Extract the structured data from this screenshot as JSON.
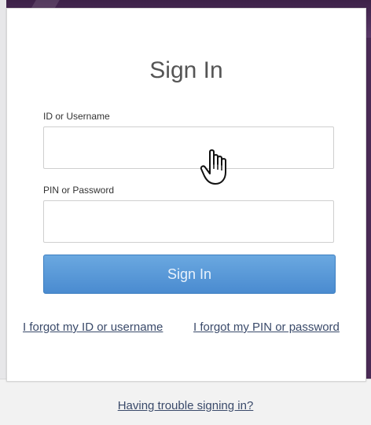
{
  "form": {
    "title": "Sign In",
    "username_label": "ID or Username",
    "username_value": "",
    "password_label": "PIN or Password",
    "password_value": "",
    "submit_label": "Sign In"
  },
  "links": {
    "forgot_id": "I forgot my ID or username",
    "forgot_pin": "I forgot my PIN or password",
    "trouble": "Having trouble signing in?"
  },
  "icons": {
    "cursor": "hand-pointer-icon"
  },
  "colors": {
    "frame": "#4a2a55",
    "button": "#4a8bd0",
    "link": "#3a4a6a"
  }
}
